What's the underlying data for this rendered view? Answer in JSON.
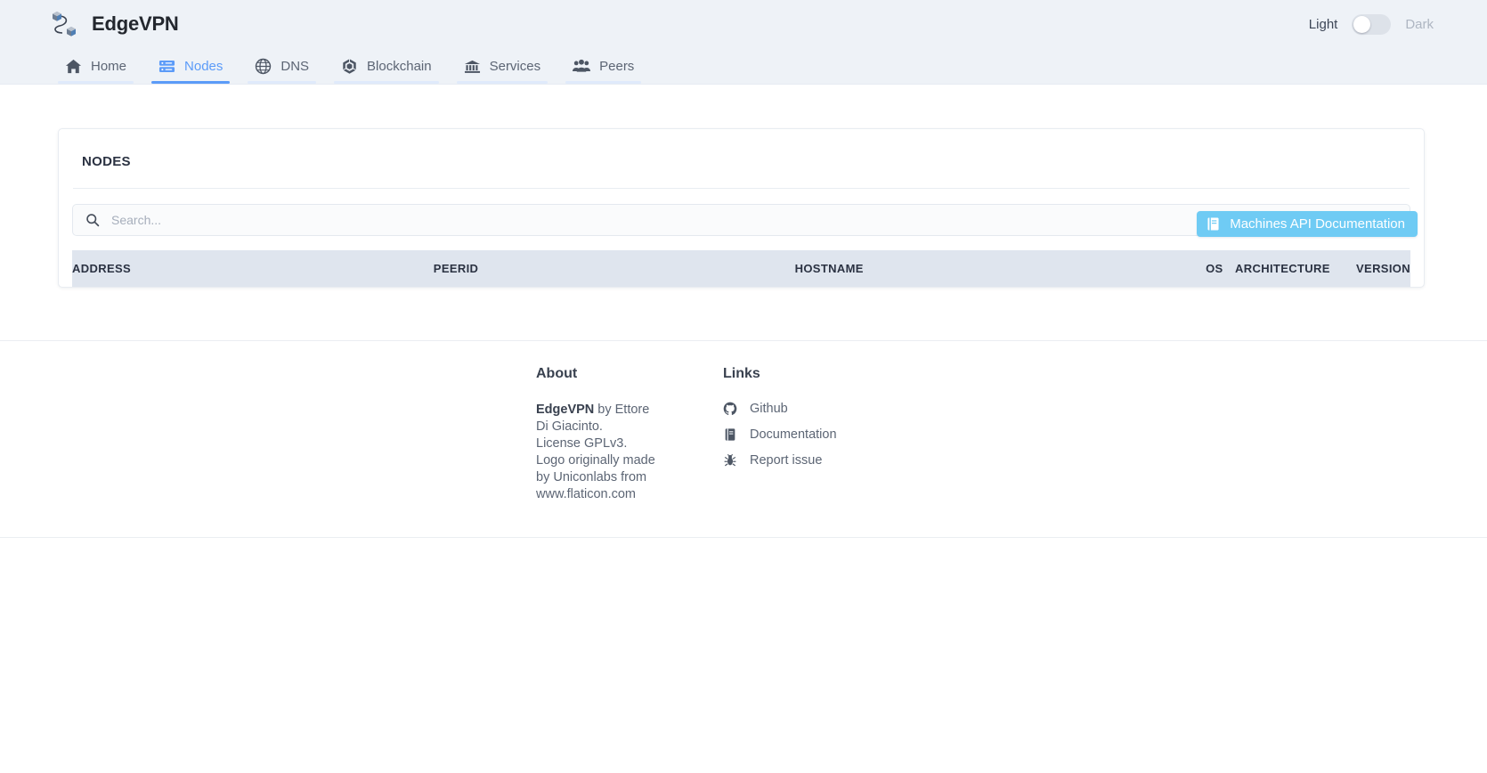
{
  "app": {
    "brand_name": "EdgeVPN",
    "logo_icon": "edgevpn-nodes-logo"
  },
  "theme": {
    "light_label": "Light",
    "dark_label": "Dark",
    "active": "Light",
    "toggle_state": "off"
  },
  "nav": {
    "items": [
      {
        "label": "Home",
        "icon": "home-icon",
        "active": false
      },
      {
        "label": "Nodes",
        "icon": "server-icon",
        "active": true
      },
      {
        "label": "DNS",
        "icon": "globe-icon",
        "active": false
      },
      {
        "label": "Blockchain",
        "icon": "blockchain-icon",
        "active": false
      },
      {
        "label": "Services",
        "icon": "bank-icon",
        "active": false
      },
      {
        "label": "Peers",
        "icon": "peers-icon",
        "active": false
      }
    ]
  },
  "main": {
    "api_doc_button": {
      "label": "Machines API Documentation",
      "icon": "book-icon",
      "color": "#6fcbf4"
    },
    "card": {
      "title": "NODES",
      "search": {
        "placeholder": "Search...",
        "value": "",
        "icon": "search-icon"
      },
      "table": {
        "columns": [
          {
            "label": "ADDRESS",
            "align": "left"
          },
          {
            "label": "PEERID",
            "align": "left"
          },
          {
            "label": "HOSTNAME",
            "align": "left"
          },
          {
            "label": "OS",
            "align": "right"
          },
          {
            "label": "ARCHITECTURE",
            "align": "right"
          },
          {
            "label": "VERSION",
            "align": "right"
          }
        ],
        "rows": []
      }
    }
  },
  "footer": {
    "about": {
      "heading": "About",
      "brand": "EdgeVPN",
      "byline": " by Ettore Di Giacinto.",
      "license": "License GPLv3.",
      "credit": "Logo originally made by Uniconlabs from www.flaticon.com"
    },
    "links": {
      "heading": "Links",
      "items": [
        {
          "label": "Github",
          "icon": "github-icon"
        },
        {
          "label": "Documentation",
          "icon": "book-icon"
        },
        {
          "label": "Report issue",
          "icon": "bug-icon"
        }
      ]
    }
  },
  "colors": {
    "accent": "#5b9bf8",
    "header_bg": "#eef2f7",
    "table_header_bg": "#dfe5ee",
    "api_button": "#6fcbf4"
  }
}
